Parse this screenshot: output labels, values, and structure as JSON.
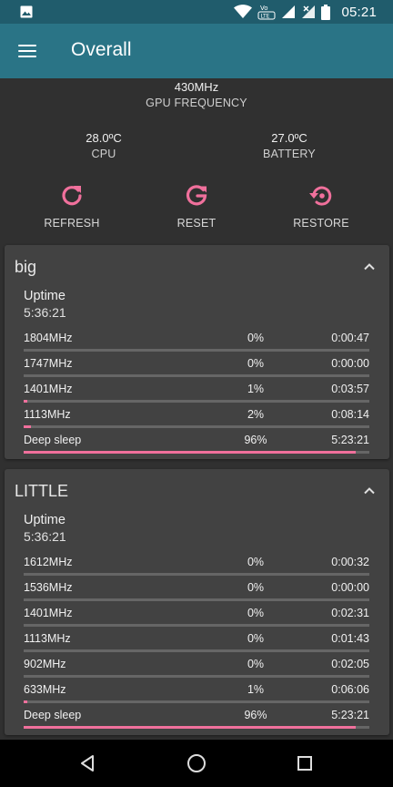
{
  "status_bar": {
    "time": "05:21",
    "icons": [
      "image-icon",
      "wifi-icon",
      "volte-icon",
      "signal-icon",
      "signal-no-data-icon",
      "battery-icon"
    ],
    "volte_text": "VoLTE"
  },
  "toolbar": {
    "title": "Overall",
    "menu_icon": "hamburger-menu-icon"
  },
  "stats": {
    "gpu": {
      "value": "430MHz",
      "label": "GPU FREQUENCY"
    },
    "cpu": {
      "value": "28.0ºC",
      "label": "CPU"
    },
    "battery": {
      "value": "27.0ºC",
      "label": "BATTERY"
    }
  },
  "actions": {
    "refresh": {
      "label": "REFRESH",
      "icon": "refresh-icon"
    },
    "reset": {
      "label": "RESET",
      "icon": "reset-icon"
    },
    "restore": {
      "label": "RESTORE",
      "icon": "restore-icon"
    }
  },
  "colors": {
    "status_bar": "#205c6c",
    "toolbar": "#2a7486",
    "accent": "#f0709c",
    "background": "#303030",
    "card": "#424242"
  },
  "clusters": [
    {
      "title": "big",
      "uptime_label": "Uptime",
      "uptime": "5:36:21",
      "rows": [
        {
          "freq": "1804MHz",
          "pct": "0%",
          "time": "0:00:47",
          "fraction": 0.0
        },
        {
          "freq": "1747MHz",
          "pct": "0%",
          "time": "0:00:00",
          "fraction": 0.0
        },
        {
          "freq": "1401MHz",
          "pct": "1%",
          "time": "0:03:57",
          "fraction": 0.01
        },
        {
          "freq": "1113MHz",
          "pct": "2%",
          "time": "0:08:14",
          "fraction": 0.02
        },
        {
          "freq": "Deep sleep",
          "pct": "96%",
          "time": "5:23:21",
          "fraction": 0.96
        }
      ]
    },
    {
      "title": "LITTLE",
      "uptime_label": "Uptime",
      "uptime": "5:36:21",
      "rows": [
        {
          "freq": "1612MHz",
          "pct": "0%",
          "time": "0:00:32",
          "fraction": 0.0
        },
        {
          "freq": "1536MHz",
          "pct": "0%",
          "time": "0:00:00",
          "fraction": 0.0
        },
        {
          "freq": "1401MHz",
          "pct": "0%",
          "time": "0:02:31",
          "fraction": 0.0
        },
        {
          "freq": "1113MHz",
          "pct": "0%",
          "time": "0:01:43",
          "fraction": 0.0
        },
        {
          "freq": "902MHz",
          "pct": "0%",
          "time": "0:02:05",
          "fraction": 0.0
        },
        {
          "freq": "633MHz",
          "pct": "1%",
          "time": "0:06:06",
          "fraction": 0.01
        },
        {
          "freq": "Deep sleep",
          "pct": "96%",
          "time": "5:23:21",
          "fraction": 0.96
        }
      ]
    }
  ],
  "nav_bar": {
    "back_icon": "back-icon",
    "home_icon": "home-icon",
    "recent_icon": "recent-apps-icon"
  }
}
